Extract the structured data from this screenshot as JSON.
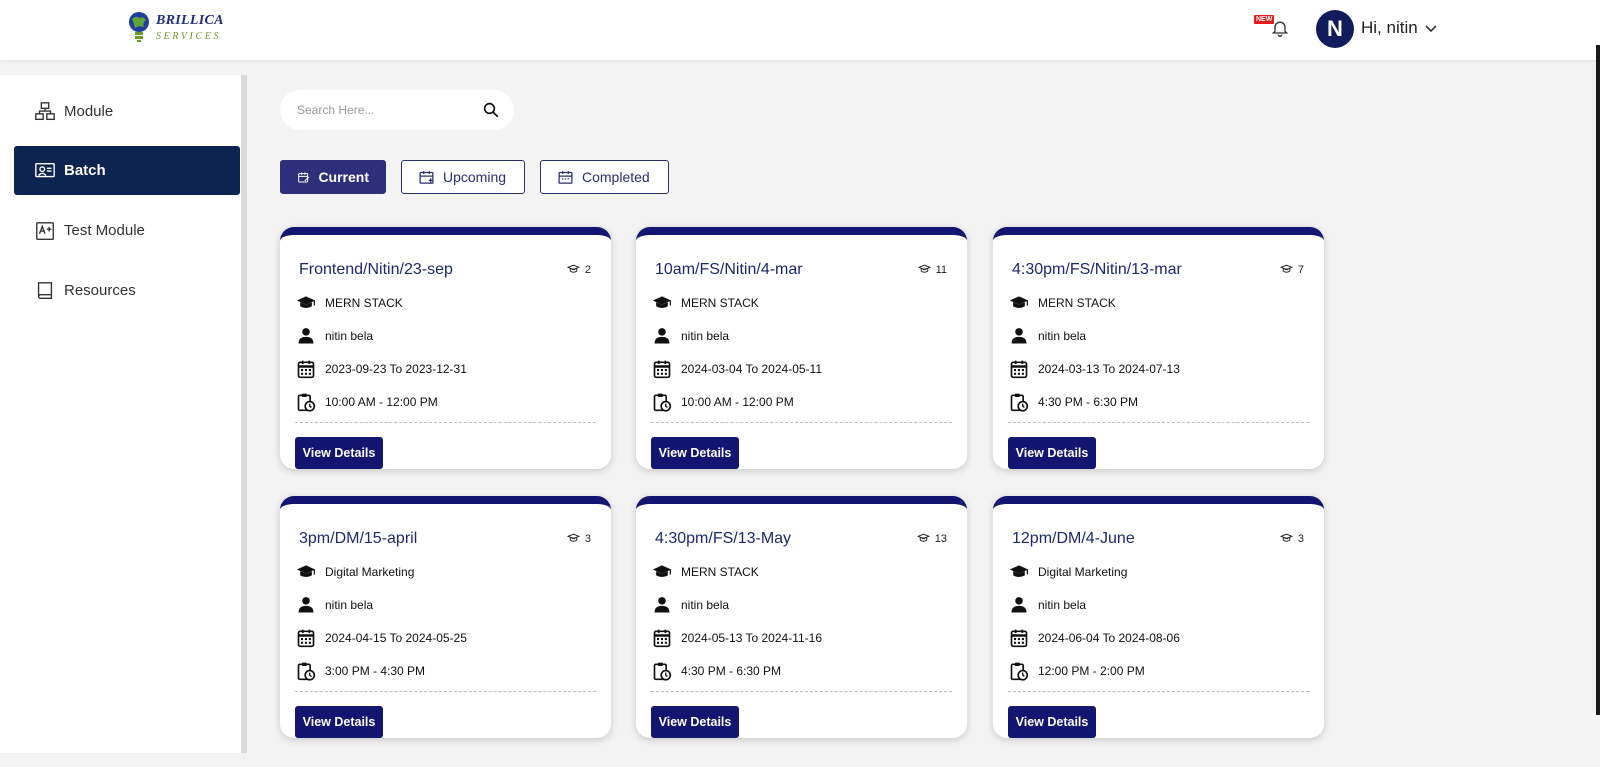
{
  "header": {
    "brand": "BRILLICA",
    "brand_sub": "SERVICES",
    "new_badge": "NEW",
    "avatar_letter": "N",
    "greeting": "Hi,  nitin"
  },
  "sidebar": {
    "items": [
      {
        "label": "Module",
        "icon": "module-icon",
        "active": false
      },
      {
        "label": "Batch",
        "icon": "batch-icon",
        "active": true
      },
      {
        "label": "Test Module",
        "icon": "test-icon",
        "active": false
      },
      {
        "label": "Resources",
        "icon": "book-icon",
        "active": false
      }
    ]
  },
  "search": {
    "placeholder": "Search Here..."
  },
  "tabs": [
    {
      "label": "Current",
      "active": true
    },
    {
      "label": "Upcoming",
      "active": false
    },
    {
      "label": "Completed",
      "active": false
    }
  ],
  "batches": [
    {
      "title": "Frontend/Nitin/23-sep",
      "count": "2",
      "course": "MERN STACK",
      "trainer": "nitin bela",
      "dates": "2023-09-23 To 2023-12-31",
      "time": "10:00 AM - 12:00 PM",
      "button": "View Details"
    },
    {
      "title": "10am/FS/Nitin/4-mar",
      "count": "11",
      "course": "MERN STACK",
      "trainer": "nitin bela",
      "dates": "2024-03-04 To 2024-05-11",
      "time": "10:00 AM - 12:00 PM",
      "button": "View Details"
    },
    {
      "title": "4:30pm/FS/Nitin/13-mar",
      "count": "7",
      "course": "MERN STACK",
      "trainer": "nitin bela",
      "dates": "2024-03-13 To 2024-07-13",
      "time": "4:30 PM - 6:30 PM",
      "button": "View Details"
    },
    {
      "title": "3pm/DM/15-april",
      "count": "3",
      "course": "Digital Marketing",
      "trainer": "nitin bela",
      "dates": "2024-04-15 To 2024-05-25",
      "time": "3:00 PM - 4:30 PM",
      "button": "View Details"
    },
    {
      "title": "4:30pm/FS/13-May",
      "count": "13",
      "course": "MERN STACK",
      "trainer": "nitin bela",
      "dates": "2024-05-13 To 2024-11-16",
      "time": "4:30 PM - 6:30 PM",
      "button": "View Details"
    },
    {
      "title": "12pm/DM/4-June",
      "count": "3",
      "course": "Digital Marketing",
      "trainer": "nitin bela",
      "dates": "2024-06-04 To 2024-08-06",
      "time": "12:00 PM - 2:00 PM",
      "button": "View Details"
    }
  ],
  "colors": {
    "primary": "#121670",
    "sidebar_active": "#0d2350",
    "tab_active": "#2e2f7a",
    "badge": "#e41b1b"
  }
}
